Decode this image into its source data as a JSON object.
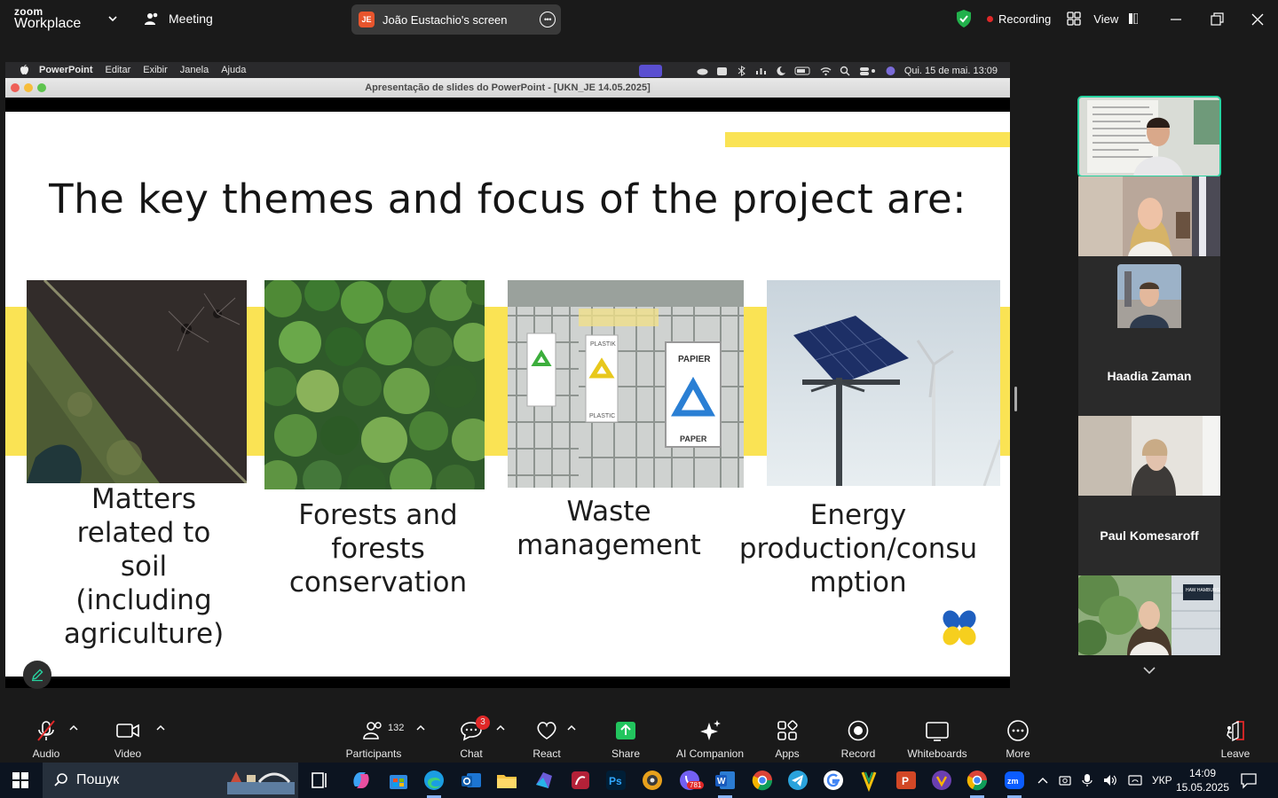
{
  "zoom": {
    "logo_line1": "zoom",
    "logo_line2": "Workplace",
    "meeting_label": "Meeting",
    "share_initials": "JE",
    "share_title": "João Eustachio's screen",
    "recording_label": "Recording",
    "view_label": "View",
    "colors": {
      "bg": "#1a1a1a",
      "accent_green": "#27d3a0",
      "rec_red": "#e02828",
      "share_badge": "#e8552d"
    }
  },
  "mac": {
    "menu_items": [
      "PowerPoint",
      "Editar",
      "Exibir",
      "Janela",
      "Ajuda"
    ],
    "datetime": "Qui. 15 de mai.  13:09",
    "window_title": "Apresentação de slides do PowerPoint - [UKN_JE 14.05.2025]"
  },
  "slide": {
    "title": "The key themes and focus of the project are:",
    "themes": [
      {
        "caption_lines": [
          "Matters",
          "related to",
          "soil",
          "(including",
          "agriculture)"
        ],
        "image": "aerial-soil-field"
      },
      {
        "caption_lines": [
          "Forests and",
          "forests",
          "conservation"
        ],
        "image": "aerial-forest"
      },
      {
        "caption_lines": [
          "Waste",
          "management"
        ],
        "image": "recycling-bins",
        "bin_labels": [
          "PAPIER",
          "PAPER",
          "PLASTIK",
          "PLASTIC"
        ]
      },
      {
        "caption_lines": [
          "Energy",
          "production/consu",
          "mption"
        ],
        "image": "solar-panel-wind-turbine"
      }
    ],
    "colors": {
      "yellow": "#fae354",
      "ukraine_blue": "#1f5fbf",
      "ukraine_yellow": "#f6cf1e"
    }
  },
  "participants": [
    {
      "name": "",
      "type": "video",
      "active": true
    },
    {
      "name": "",
      "type": "video"
    },
    {
      "name": "Haadia Zaman",
      "type": "avatar"
    },
    {
      "name": "",
      "type": "video"
    },
    {
      "name": "Paul Komesaroff",
      "type": "name-only"
    },
    {
      "name": "",
      "type": "video",
      "overlay_text": "HAW HAMBURG"
    }
  ],
  "toolbar": {
    "audio": "Audio",
    "video": "Video",
    "participants": "Participants",
    "participants_count": "132",
    "chat": "Chat",
    "chat_badge": "3",
    "react": "React",
    "share": "Share",
    "ai_companion": "AI Companion",
    "apps": "Apps",
    "record": "Record",
    "whiteboards": "Whiteboards",
    "more": "More",
    "leave": "Leave"
  },
  "taskbar": {
    "search_placeholder": "Пошук",
    "viber_badge": "781",
    "language": "УКР",
    "time": "14:09",
    "date": "15.05.2025"
  }
}
